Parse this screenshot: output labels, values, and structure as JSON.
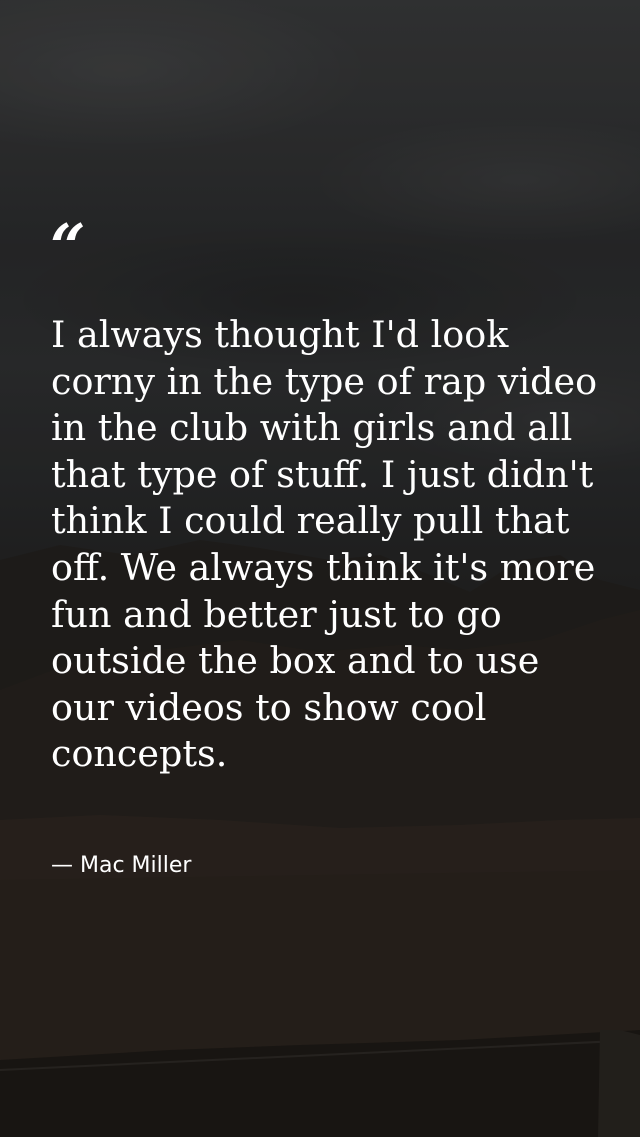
{
  "quote": {
    "mark": "“",
    "text": "I always thought I'd look corny in the type of rap video in the club with girls and all that type of stuff. I just didn't think I could really pull that off. We always think it's more fun and better just to go outside the box and to use our videos to show cool concepts.",
    "author": "— Mac Miller"
  },
  "colors": {
    "text": "#ffffff",
    "sky": "#333435",
    "ground": "#2a241e"
  }
}
